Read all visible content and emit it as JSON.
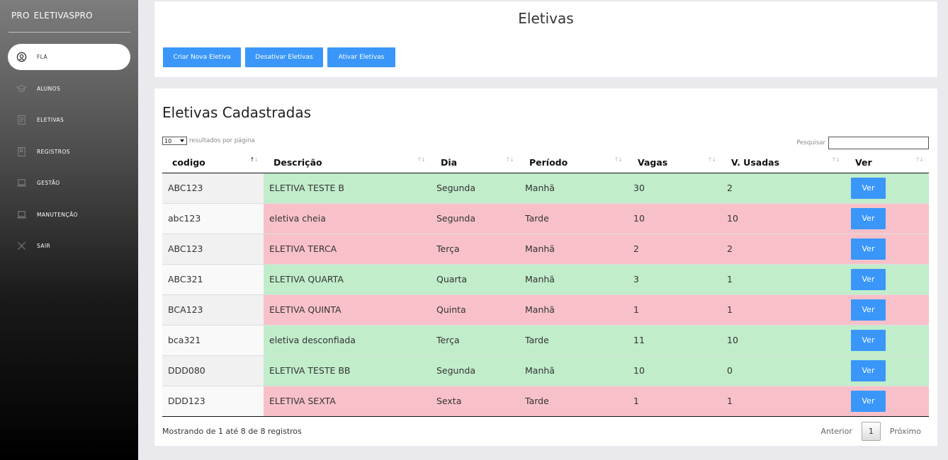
{
  "sidebar": {
    "brand_a": "PRO",
    "brand_b": "ELETIVASPRO",
    "items": [
      {
        "label": "FLA",
        "icon": "user-circle-icon",
        "active": true
      },
      {
        "label": "ALUNOS",
        "icon": "graduation-cap-icon",
        "active": false
      },
      {
        "label": "ELETIVAS",
        "icon": "document-icon",
        "active": false
      },
      {
        "label": "REGISTROS",
        "icon": "book-icon",
        "active": false
      },
      {
        "label": "GESTÃO",
        "icon": "laptop-icon",
        "active": false
      },
      {
        "label": "MANUTENÇÃO",
        "icon": "laptop-icon",
        "active": false
      },
      {
        "label": "SAIR",
        "icon": "close-icon",
        "active": false
      }
    ]
  },
  "header": {
    "title": "Eletivas",
    "buttons": {
      "criar": "Criar Nova Eletiva",
      "desativar": "Desativar Eletivas",
      "ativar": "Ativar Eletivas"
    }
  },
  "main": {
    "title": "Eletivas Cadastradas",
    "length_value": "10",
    "length_label": "resultados por página",
    "search_label": "Pesquisar",
    "search_value": "",
    "columns": [
      "codigo",
      "Descrição",
      "Dia",
      "Período",
      "Vagas",
      "V. Usadas",
      "Ver"
    ],
    "sorted_column": "codigo",
    "rows": [
      {
        "codigo": "ABC123",
        "descricao": "ELETIVA TESTE B",
        "dia": "Segunda",
        "periodo": "Manhã",
        "vagas": "30",
        "usadas": "2",
        "ver": "Ver",
        "status": "green"
      },
      {
        "codigo": "abc123",
        "descricao": "eletiva cheia",
        "dia": "Segunda",
        "periodo": "Tarde",
        "vagas": "10",
        "usadas": "10",
        "ver": "Ver",
        "status": "red"
      },
      {
        "codigo": "ABC123",
        "descricao": "ELETIVA TERCA",
        "dia": "Terça",
        "periodo": "Manhã",
        "vagas": "2",
        "usadas": "2",
        "ver": "Ver",
        "status": "red"
      },
      {
        "codigo": "ABC321",
        "descricao": "ELETIVA QUARTA",
        "dia": "Quarta",
        "periodo": "Manhã",
        "vagas": "3",
        "usadas": "1",
        "ver": "Ver",
        "status": "green"
      },
      {
        "codigo": "BCA123",
        "descricao": "ELETIVA QUINTA",
        "dia": "Quinta",
        "periodo": "Manhã",
        "vagas": "1",
        "usadas": "1",
        "ver": "Ver",
        "status": "red"
      },
      {
        "codigo": "bca321",
        "descricao": "eletiva desconfiada",
        "dia": "Terça",
        "periodo": "Tarde",
        "vagas": "11",
        "usadas": "10",
        "ver": "Ver",
        "status": "green"
      },
      {
        "codigo": "DDD080",
        "descricao": "ELETIVA TESTE BB",
        "dia": "Segunda",
        "periodo": "Manhã",
        "vagas": "10",
        "usadas": "0",
        "ver": "Ver",
        "status": "green"
      },
      {
        "codigo": "DDD123",
        "descricao": "ELETIVA SEXTA",
        "dia": "Sexta",
        "periodo": "Tarde",
        "vagas": "1",
        "usadas": "1",
        "ver": "Ver",
        "status": "red"
      }
    ],
    "info": "Mostrando de 1 até 8 de 8 registros",
    "pager": {
      "prev": "Anterior",
      "page": "1",
      "next": "Próximo"
    }
  },
  "colors": {
    "accent": "#3a97f9",
    "row_green": "#c1edcb",
    "row_red": "#f8c1c9"
  }
}
